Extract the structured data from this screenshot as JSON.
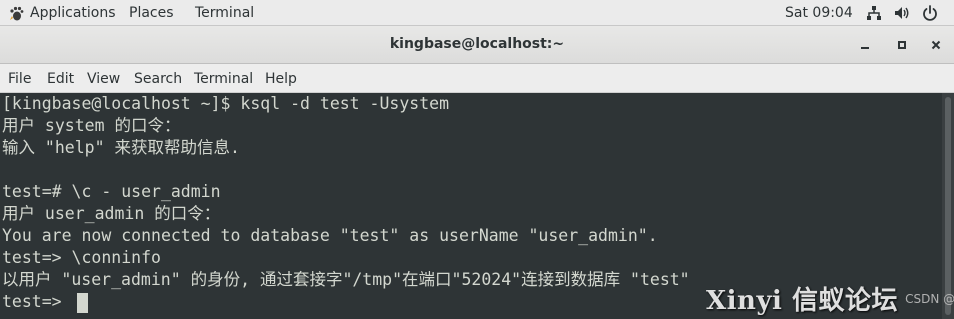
{
  "topbar": {
    "applications": "Applications",
    "places": "Places",
    "terminal": "Terminal",
    "clock": "Sat 09:04"
  },
  "window": {
    "title": "kingbase@localhost:~"
  },
  "menubar": {
    "items": [
      "File",
      "Edit",
      "View",
      "Search",
      "Terminal",
      "Help"
    ]
  },
  "terminal": {
    "lines": [
      "[kingbase@localhost ~]$ ksql -d test -Usystem",
      "用户 system 的口令：",
      "输入 \"help\" 来获取帮助信息.",
      "",
      "test=# \\c - user_admin",
      "用户 user_admin 的口令：",
      "You are now connected to database \"test\" as userName \"user_admin\".",
      "test=> \\conninfo",
      "以用户 \"user_admin\" 的身份, 通过套接字\"/tmp\"在端口\"52024\"连接到数据库 \"test\"",
      "test=> "
    ]
  },
  "watermark": {
    "brand": "Xinyi 信蚁论坛",
    "sub": "CSDN @liuzizif"
  },
  "colors": {
    "terminal_bg": "#2e3436",
    "terminal_fg": "#d3d7cf",
    "topbar_bg": "#ebebeb",
    "titlebar_bg": "#e0e0df"
  },
  "icons": {
    "topbar_apps": "applications-foot-icon",
    "network": "network-icon",
    "volume": "volume-icon",
    "power": "power-icon",
    "minimize": "minimize-icon",
    "maximize": "maximize-icon",
    "close": "close-icon"
  }
}
